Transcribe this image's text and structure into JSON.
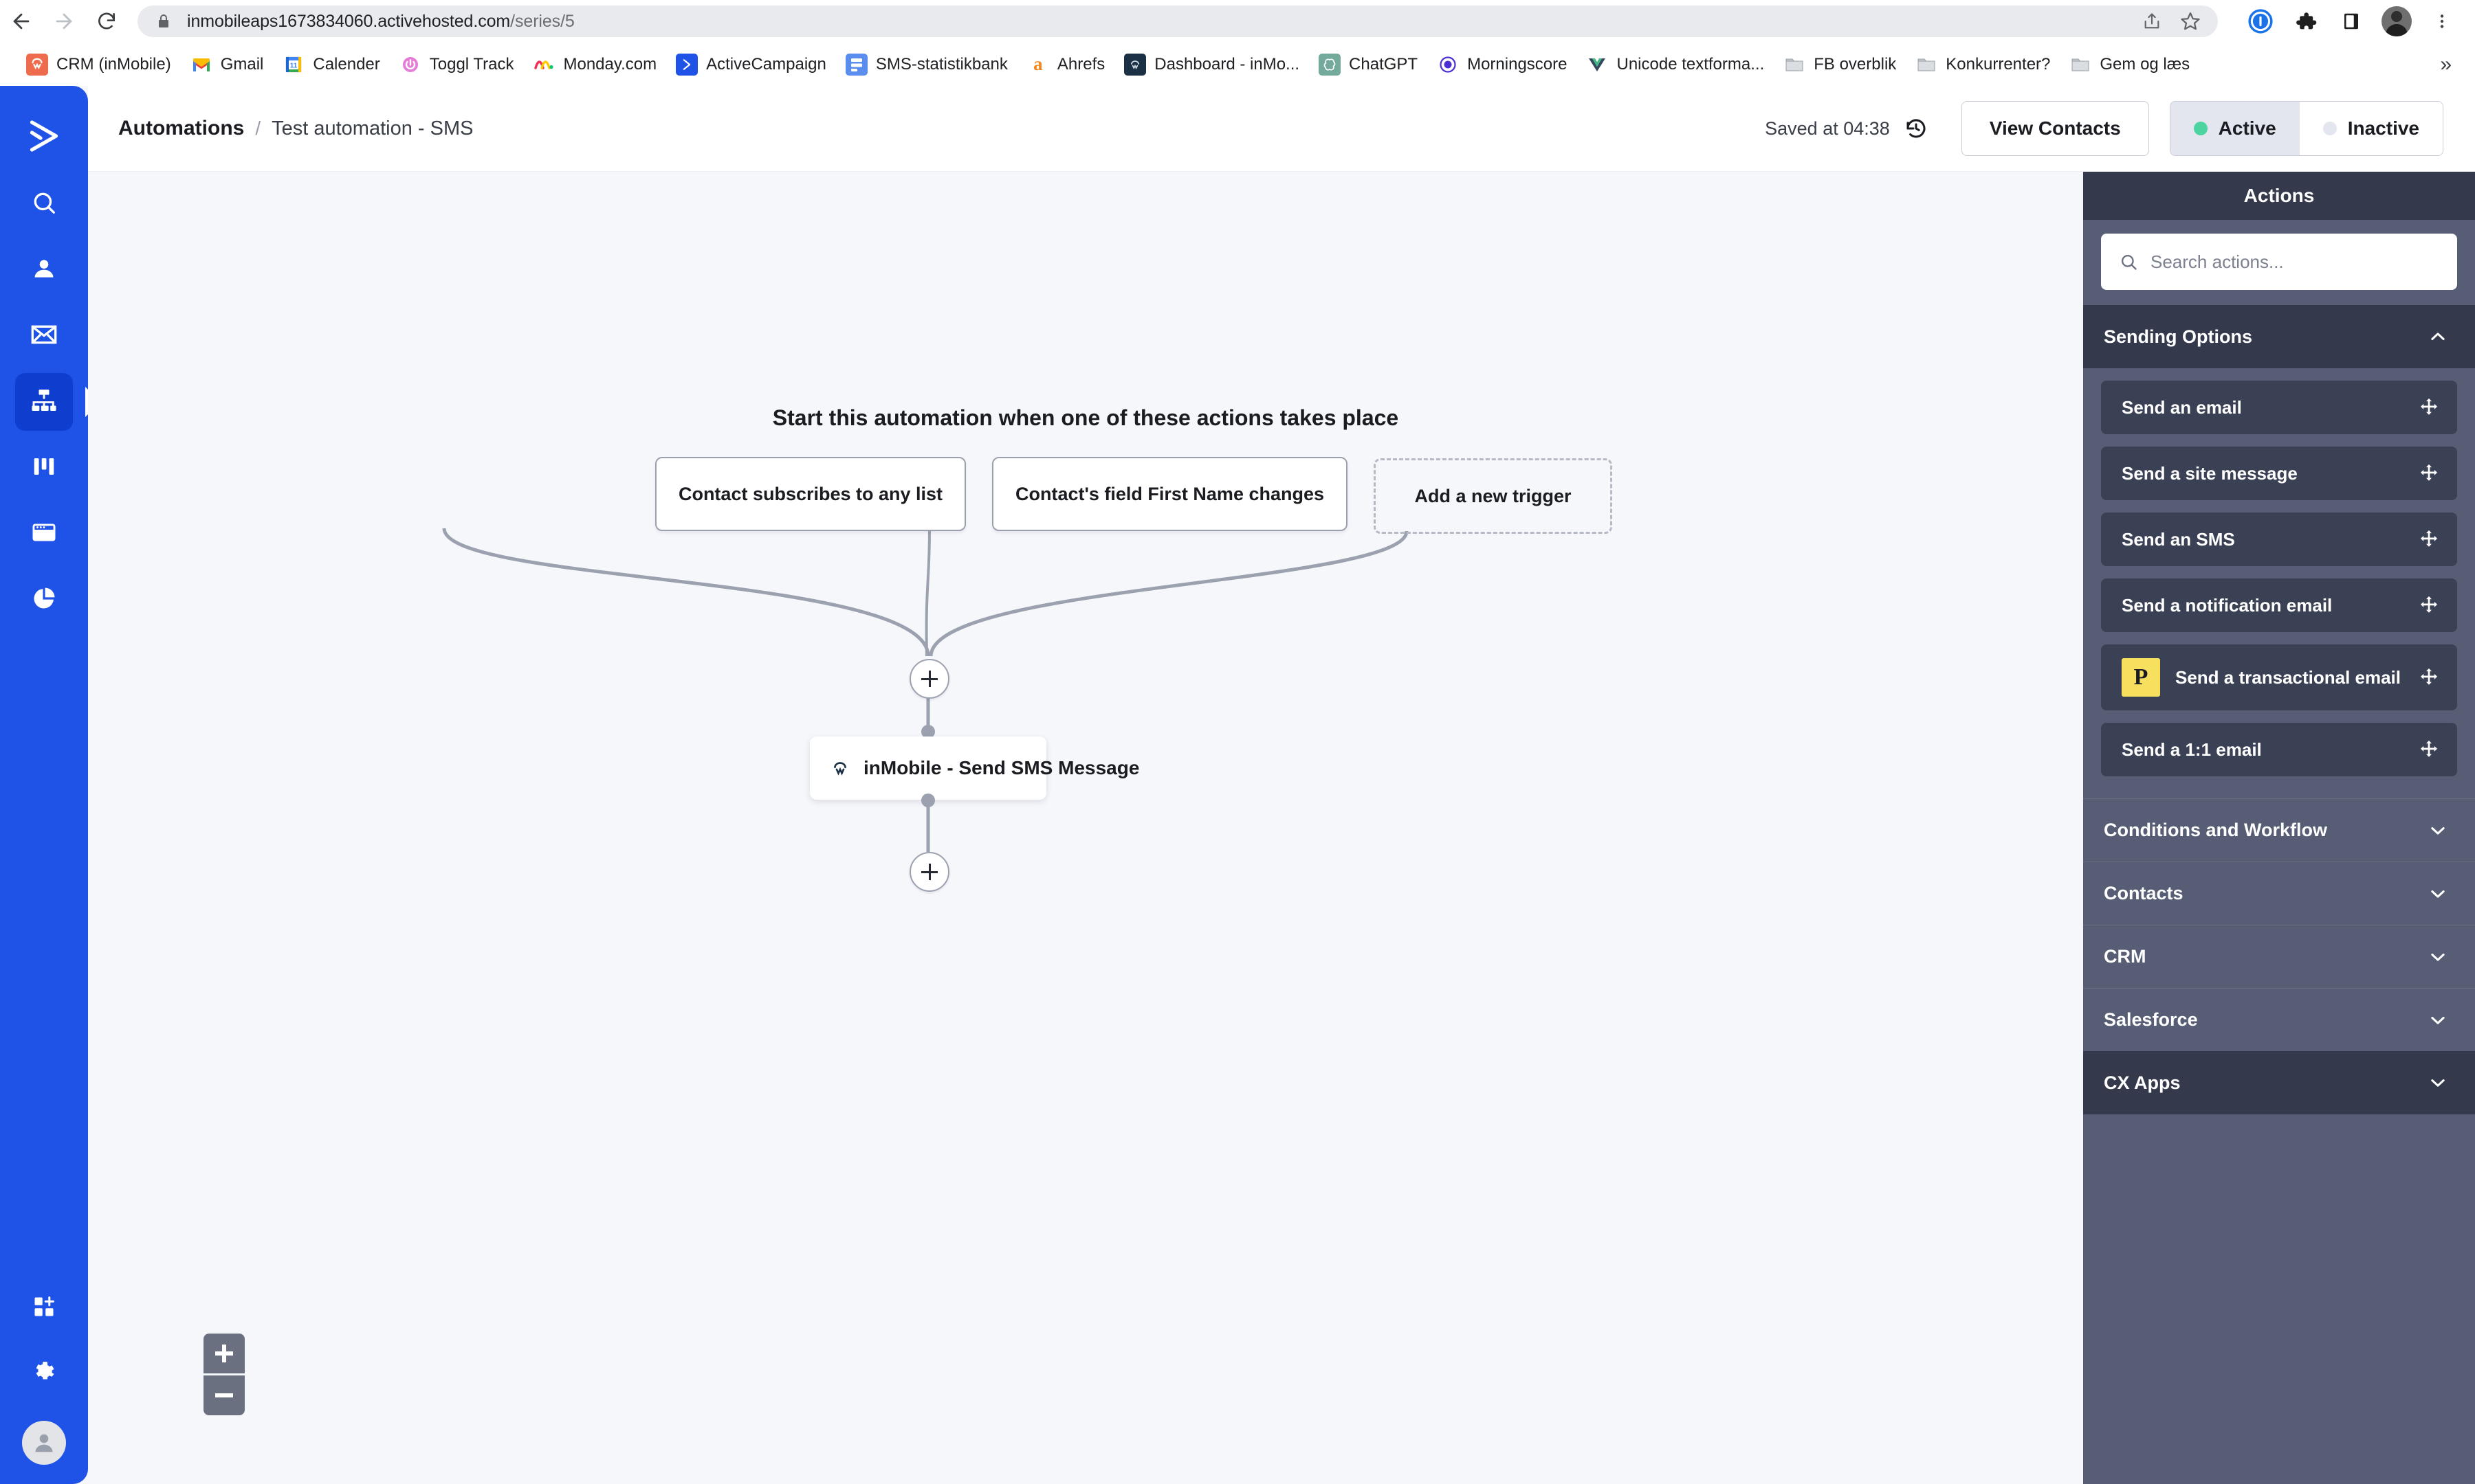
{
  "browser": {
    "url_host": "inmobileaps1673834060.activehosted.com",
    "url_path": "/series/5",
    "nav": {
      "back": "back-arrow",
      "forward": "forward-arrow",
      "reload": "reload"
    },
    "omnibox_icons": [
      "share-icon",
      "bookmark-star-icon"
    ],
    "toolbar_icons": [
      "1password-icon",
      "extensions-puzzle-icon",
      "sidebar-panel-icon",
      "profile-avatar",
      "chrome-menu-icon"
    ],
    "bookmarks": [
      {
        "label": "CRM (inMobile)",
        "icon": "crm-inmobile-icon",
        "color": "#ee6c4d",
        "glyph": "●"
      },
      {
        "label": "Gmail",
        "icon": "gmail-icon",
        "color": "#ffffff",
        "glyph": "M"
      },
      {
        "label": "Calender",
        "icon": "google-calendar-icon",
        "color": "#ffffff",
        "glyph": "11"
      },
      {
        "label": "Toggl Track",
        "icon": "toggl-icon",
        "color": "#e57cd8",
        "glyph": "⏻"
      },
      {
        "label": "Monday.com",
        "icon": "monday-icon",
        "color": "#ffffff",
        "glyph": "‖"
      },
      {
        "label": "ActiveCampaign",
        "icon": "activecampaign-icon",
        "color": "#1f53e8",
        "glyph": "❯"
      },
      {
        "label": "SMS-statistikbank",
        "icon": "sms-statistikbank-icon",
        "color": "#5b8def",
        "glyph": "≡"
      },
      {
        "label": "Ahrefs",
        "icon": "ahrefs-icon",
        "color": "#ffffff",
        "glyph": "a"
      },
      {
        "label": "Dashboard - inMo...",
        "icon": "inmobile-dashboard-icon",
        "color": "#1b3044",
        "glyph": "◔"
      },
      {
        "label": "ChatGPT",
        "icon": "chatgpt-icon",
        "color": "#74aa9c",
        "glyph": "◎"
      },
      {
        "label": "Morningscore",
        "icon": "morningscore-icon",
        "color": "#ffffff",
        "glyph": "◉"
      },
      {
        "label": "Unicode textforma...",
        "icon": "vue-icon",
        "color": "#ffffff",
        "glyph": "▼"
      },
      {
        "label": "FB overblik",
        "icon": "folder-icon",
        "color": "#bdc1c6",
        "glyph": "▤"
      },
      {
        "label": "Konkurrenter?",
        "icon": "folder-icon",
        "color": "#bdc1c6",
        "glyph": "▤"
      },
      {
        "label": "Gem og læs",
        "icon": "folder-icon",
        "color": "#bdc1c6",
        "glyph": "▤"
      }
    ],
    "bookmarks_overflow": "»"
  },
  "sidebar": {
    "logo": "activecampaign-logo",
    "items": [
      {
        "name": "search",
        "icon": "search-icon",
        "active": false
      },
      {
        "name": "contacts",
        "icon": "person-icon",
        "active": false
      },
      {
        "name": "campaigns",
        "icon": "envelope-icon",
        "active": false
      },
      {
        "name": "automations",
        "icon": "automations-flow-icon",
        "active": true
      },
      {
        "name": "deals",
        "icon": "kanban-columns-icon",
        "active": false
      },
      {
        "name": "website",
        "icon": "browser-window-icon",
        "active": false
      },
      {
        "name": "reports",
        "icon": "pie-chart-icon",
        "active": false
      }
    ],
    "bottom_items": [
      {
        "name": "apps",
        "icon": "apps-grid-plus-icon"
      },
      {
        "name": "settings",
        "icon": "gear-icon"
      },
      {
        "name": "account",
        "icon": "user-avatar-icon"
      }
    ]
  },
  "header": {
    "breadcrumb_root": "Automations",
    "breadcrumb_separator": "/",
    "breadcrumb_current": "Test automation - SMS",
    "saved_text": "Saved at 04:38",
    "history_icon": "history-clock-icon",
    "view_contacts_label": "View Contacts",
    "status": {
      "active_label": "Active",
      "inactive_label": "Inactive",
      "selected": "Active",
      "active_dot_color": "#4cd4a0",
      "inactive_dot_color": "#e3e6ee"
    }
  },
  "canvas": {
    "title": "Start this automation when one of these actions takes place",
    "triggers": [
      {
        "label": "Contact subscribes to any list",
        "style": "solid"
      },
      {
        "label": "Contact's field First Name changes",
        "style": "solid"
      },
      {
        "label": "Add a new trigger",
        "style": "dashed"
      }
    ],
    "step": {
      "label": "inMobile - Send SMS Message",
      "icon": "inmobile-app-icon"
    },
    "add_node_icon": "plus-icon",
    "zoom_in_icon": "zoom-in-icon",
    "zoom_out_icon": "zoom-out-icon"
  },
  "actions_panel": {
    "title": "Actions",
    "search_placeholder": "Search actions...",
    "search_value": "",
    "search_icon": "search-icon",
    "sections": [
      {
        "label": "Sending Options",
        "expanded": true,
        "chevron": "chevron-up-icon",
        "items": [
          {
            "label": "Send an email",
            "badge": null,
            "drag_icon": "drag-move-icon"
          },
          {
            "label": "Send a site message",
            "badge": null,
            "drag_icon": "drag-move-icon"
          },
          {
            "label": "Send an SMS",
            "badge": null,
            "drag_icon": "drag-move-icon"
          },
          {
            "label": "Send a notification email",
            "badge": null,
            "drag_icon": "drag-move-icon"
          },
          {
            "label": "Send a transactional email",
            "badge": "P",
            "badge_color": "#f6e05e",
            "drag_icon": "drag-move-icon"
          },
          {
            "label": "Send a 1:1 email",
            "badge": null,
            "drag_icon": "drag-move-icon"
          }
        ]
      },
      {
        "label": "Conditions and Workflow",
        "expanded": false,
        "chevron": "chevron-down-icon",
        "items": []
      },
      {
        "label": "Contacts",
        "expanded": false,
        "chevron": "chevron-down-icon",
        "items": []
      },
      {
        "label": "CRM",
        "expanded": false,
        "chevron": "chevron-down-icon",
        "items": []
      },
      {
        "label": "Salesforce",
        "expanded": false,
        "chevron": "chevron-down-icon",
        "items": []
      },
      {
        "label": "CX Apps",
        "expanded": false,
        "chevron": "chevron-down-icon",
        "dark": true,
        "items": []
      }
    ]
  }
}
